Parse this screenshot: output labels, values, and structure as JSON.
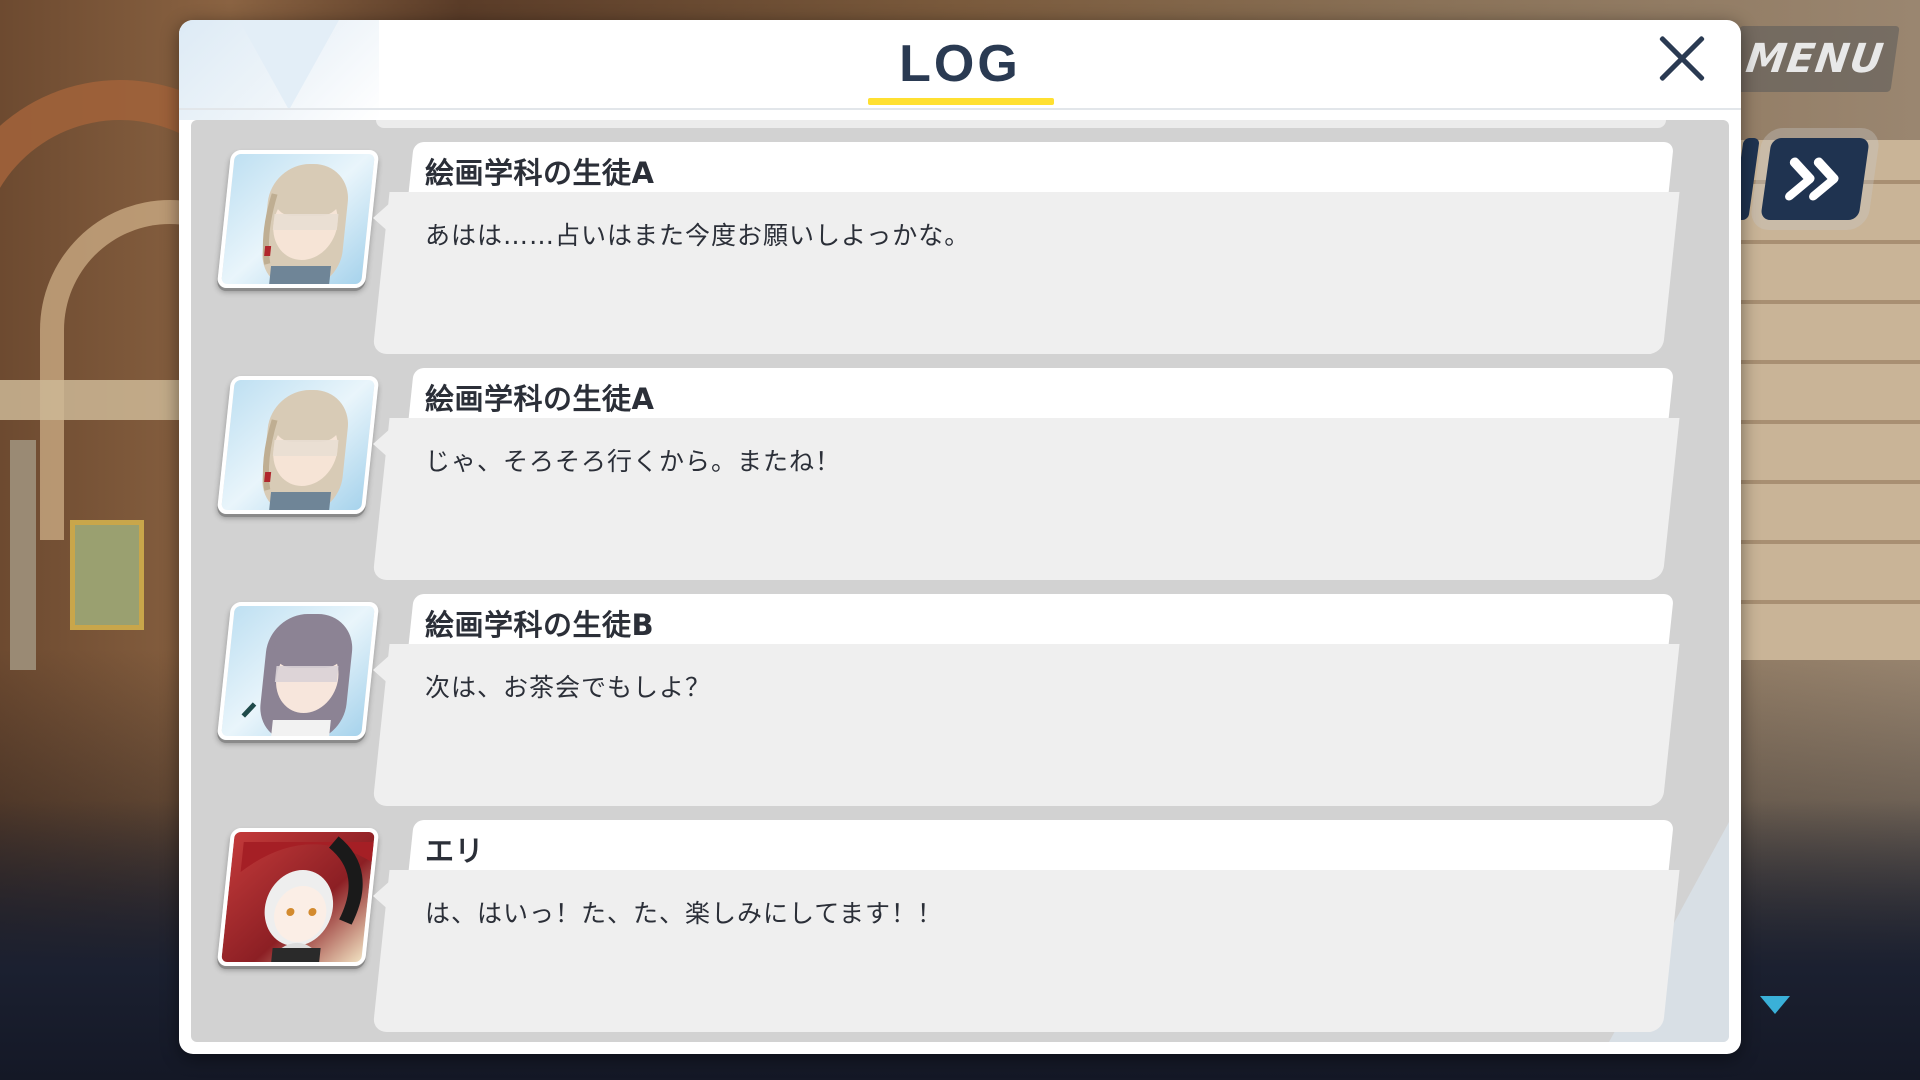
{
  "hud": {
    "menu_label": "MENU",
    "fast_forward_icon": "double-chevron-right-icon",
    "scroll_down_icon": "triangle-down-icon"
  },
  "dialog": {
    "title": "LOG",
    "close_icon": "close-icon",
    "accent_color": "#ffe031",
    "title_color": "#2a3a52"
  },
  "entries": [
    {
      "speaker": "絵画学科の生徒A",
      "text": "あはは……占いはまた今度お願いしよっかな。",
      "portrait": "student-a-portrait"
    },
    {
      "speaker": "絵画学科の生徒A",
      "text": "じゃ、そろそろ行くから。またね！",
      "portrait": "student-a-portrait"
    },
    {
      "speaker": "絵画学科の生徒B",
      "text": "次は、お茶会でもしよ？",
      "portrait": "student-b-portrait"
    },
    {
      "speaker": "エリ",
      "text": "は、はいっ！た、た、楽しみにしてます！！",
      "portrait": "eri-portrait"
    }
  ]
}
